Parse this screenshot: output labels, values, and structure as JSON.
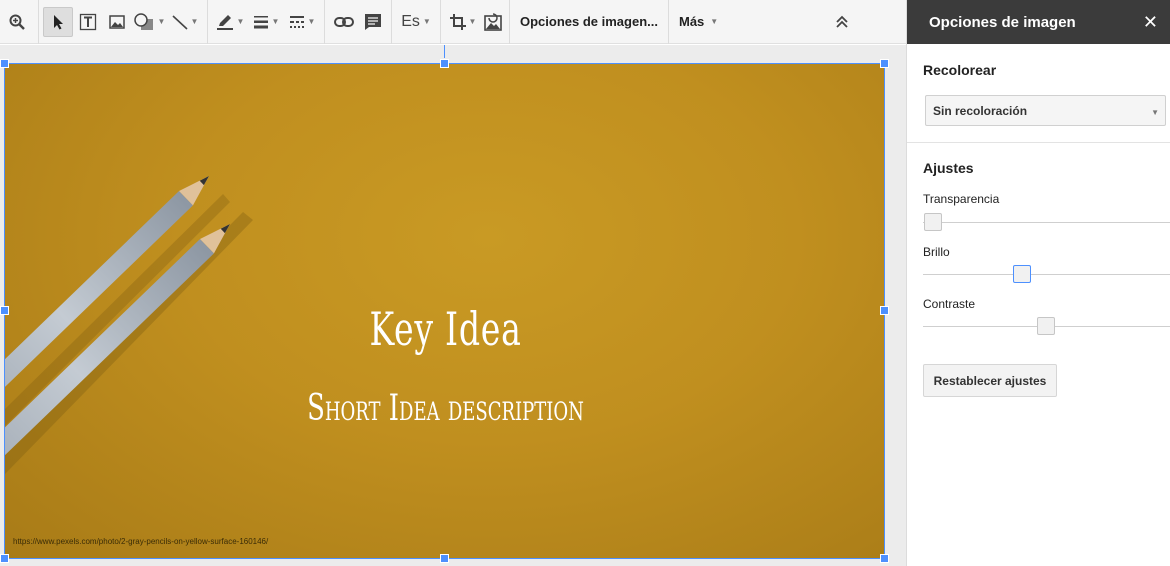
{
  "toolbar": {
    "icons": [
      "zoom-icon",
      "select-icon",
      "textbox-icon",
      "image-icon",
      "shape-icon",
      "line-icon",
      "border-color-icon",
      "border-weight-icon",
      "border-dash-icon",
      "link-icon",
      "comment-icon",
      "crop-icon",
      "reset-image-icon",
      "collapse-icon"
    ],
    "lang_label": "Es",
    "image_options_label": "Opciones de imagen...",
    "more_label": "Más"
  },
  "slide": {
    "title": "Key Idea",
    "subtitle": "Short Idea description",
    "credit": "https://www.pexels.com/photo/2-gray-pencils-on-yellow-surface-160146/"
  },
  "panel": {
    "title": "Opciones de imagen",
    "recolor": {
      "heading": "Recolorear",
      "selected": "Sin recoloración"
    },
    "adjustments": {
      "heading": "Ajustes",
      "sliders": [
        {
          "label": "Transparencia",
          "value": 0.0
        },
        {
          "label": "Brillo",
          "value": 0.4
        },
        {
          "label": "Contraste",
          "value": 0.5
        }
      ]
    },
    "reset_label": "Restablecer ajustes"
  },
  "colors": {
    "accent": "#4d90fe",
    "panel_header": "#3b3b3b",
    "slide_background": "#c29320"
  }
}
